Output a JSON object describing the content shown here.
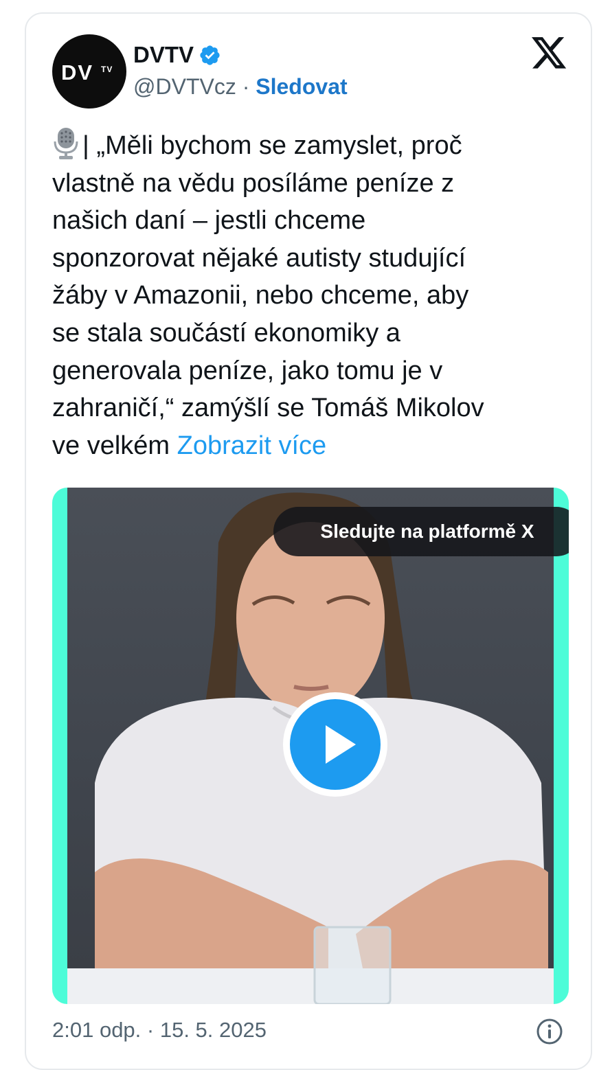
{
  "tweet": {
    "author": {
      "avatar_text": "DV",
      "avatar_superscript": "TV",
      "display_name": "DVTV",
      "handle": "@DVTVcz",
      "separator": " · ",
      "follow_label": "Sledovat",
      "verified": true
    },
    "text_lines": [
      "| „Měli bychom se zamyslet, proč",
      "vlastně na vědu posíláme peníze z",
      "našich daní – jestli chceme",
      "sponzorovat nějaké autisty studující",
      "žáby v Amazonii, nebo chceme, aby",
      "se stala součástí ekonomiky a",
      "generovala peníze, jako tomu je v",
      "zahraničí,“ zamýšlí se Tomáš Mikolov",
      "ve velkém "
    ],
    "show_more_label": "Zobrazit více",
    "leading_icon": "microphone-icon",
    "media": {
      "type": "video",
      "overlay_label": "Sledujte na platformě X",
      "play_icon": "play-icon"
    },
    "timestamp": "2:01 odp. · 15. 5. 2025"
  },
  "colors": {
    "link_blue": "#1d9bf0",
    "follow_blue": "#1d77c9",
    "text": "#0f1419",
    "muted": "#536471",
    "video_border": "#4dfcd8"
  }
}
